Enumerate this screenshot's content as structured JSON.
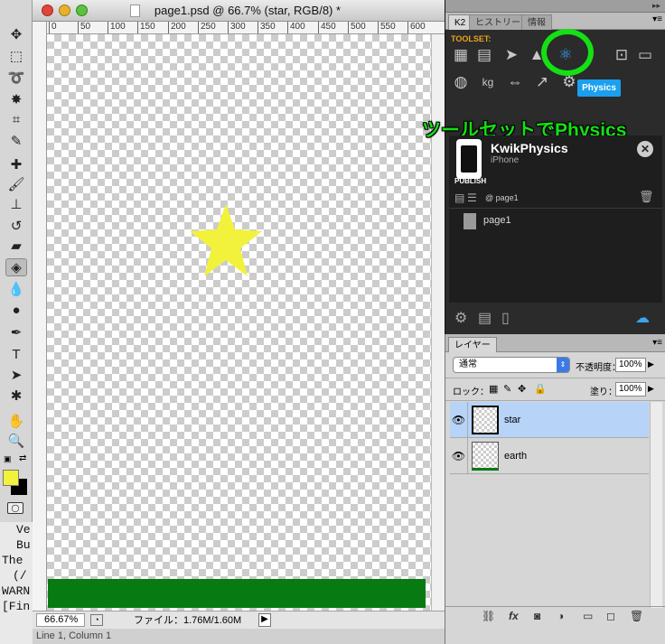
{
  "document": {
    "title": "page1.psd @ 66.7% (star, RGB/8) *",
    "ruler_marks": [
      "0",
      "50",
      "100",
      "150",
      "200",
      "250",
      "300",
      "350",
      "400",
      "450",
      "500",
      "550",
      "600"
    ],
    "zoom": "66.67%",
    "file_info": "ファイル：1.76M/1.60M",
    "footer": "Line 1, Column 1"
  },
  "console_lines": [
    "Ve",
    "Bu",
    "The",
    "(/",
    "WARN",
    "[Fin"
  ],
  "k2": {
    "tabs": [
      "K2",
      "ヒストリー",
      "情報"
    ],
    "toolset_label": "TOOLSET:",
    "physics_tooltip": "Physics",
    "annotation": "ツールセットでPhysics",
    "project_name": "KwikPhysics",
    "project_device": "iPhone",
    "publish_label": "PUBLISH",
    "page_ref": "@ page1",
    "page_item": "page1"
  },
  "layers": {
    "tab": "レイヤー",
    "blend_mode": "通常",
    "opacity_label": "不透明度：",
    "opacity_value": "100%",
    "lock_label": "ロック：",
    "fill_label": "塗り：",
    "fill_value": "100%",
    "items": [
      {
        "name": "star"
      },
      {
        "name": "earth"
      }
    ]
  },
  "colors": {
    "star": "#f2f23c",
    "earth": "#087a12",
    "highlight_circle": "#14e014",
    "selected_layer": "#b7d3f7"
  }
}
